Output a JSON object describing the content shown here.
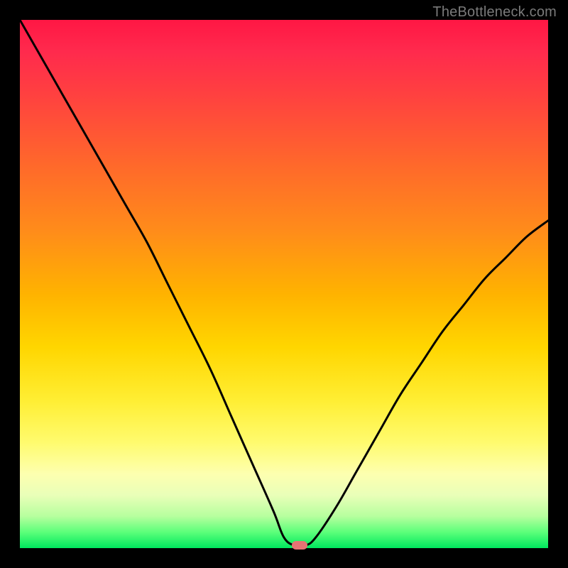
{
  "watermark": "TheBottleneck.com",
  "chart_data": {
    "type": "line",
    "title": "",
    "xlabel": "",
    "ylabel": "",
    "xlim": [
      0,
      100
    ],
    "ylim": [
      0,
      100
    ],
    "grid": false,
    "legend": false,
    "series": [
      {
        "name": "bottleneck-curve",
        "x": [
          0,
          4,
          8,
          12,
          16,
          20,
          24,
          28,
          32,
          36,
          40,
          44,
          48,
          50,
          52,
          54,
          56,
          60,
          64,
          68,
          72,
          76,
          80,
          84,
          88,
          92,
          96,
          100
        ],
        "y": [
          100,
          93,
          86,
          79,
          72,
          65,
          58,
          50,
          42,
          34,
          25,
          16,
          7,
          2,
          0.5,
          0.5,
          2,
          8,
          15,
          22,
          29,
          35,
          41,
          46,
          51,
          55,
          59,
          62
        ]
      }
    ],
    "marker": {
      "x": 53,
      "y": 0.5
    },
    "background_gradient": {
      "orientation": "vertical",
      "stops": [
        {
          "pos": 0.0,
          "color": "#ff1744"
        },
        {
          "pos": 0.28,
          "color": "#ff6a2a"
        },
        {
          "pos": 0.52,
          "color": "#ffb300"
        },
        {
          "pos": 0.72,
          "color": "#ffee33"
        },
        {
          "pos": 0.9,
          "color": "#e9ffb8"
        },
        {
          "pos": 1.0,
          "color": "#00e85e"
        }
      ]
    }
  }
}
